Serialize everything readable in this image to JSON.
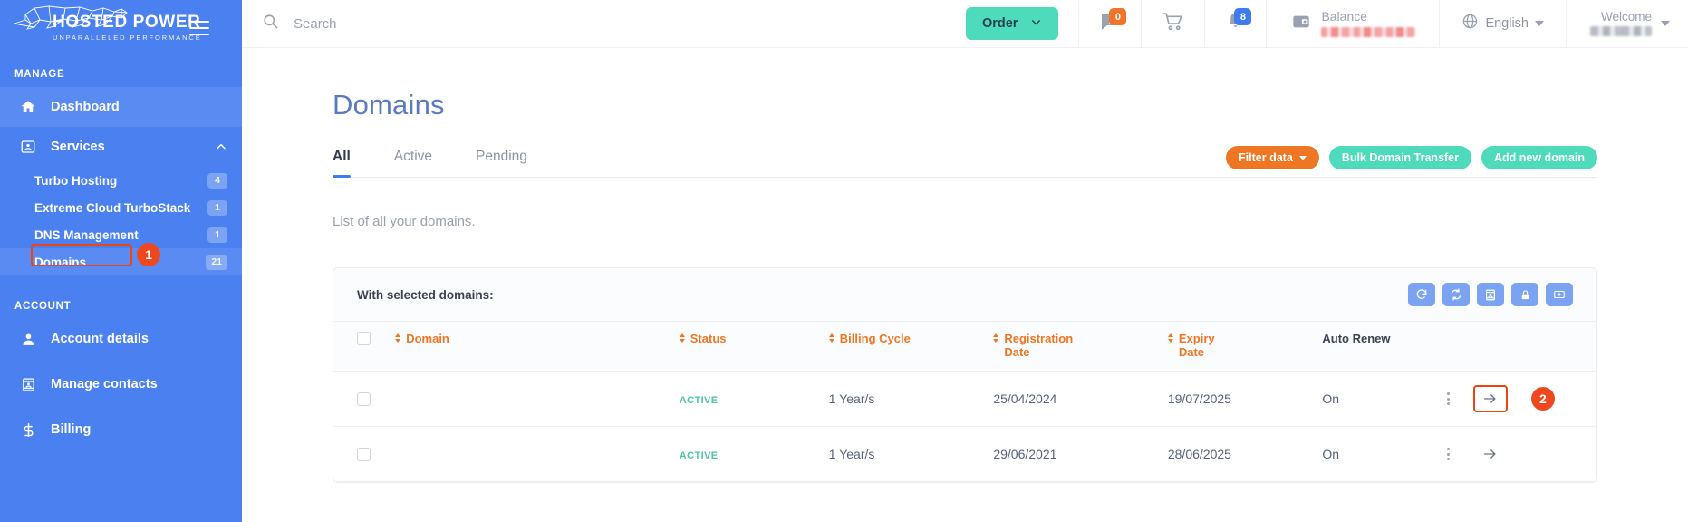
{
  "brand": {
    "name": "HOSTED POWER",
    "tagline": "UNPARALLELED PERFORMANCE",
    "logo_icon": "cheetah-logo-icon",
    "menu_icon": "hamburger-menu-icon"
  },
  "sidebar": {
    "sections": [
      {
        "label": "MANAGE"
      },
      {
        "label": "ACCOUNT"
      }
    ],
    "manage_items": [
      {
        "label": "Dashboard",
        "icon": "home-icon",
        "badge": null
      },
      {
        "label": "Services",
        "icon": "services-card-icon",
        "badge": null,
        "expand_icon": "chevron-up-icon"
      }
    ],
    "services_children": [
      {
        "label": "Turbo Hosting",
        "badge": "4"
      },
      {
        "label": "Extreme Cloud TurboStack",
        "badge": "1"
      },
      {
        "label": "DNS Management",
        "badge": "1"
      },
      {
        "label": "Domains",
        "badge": "21",
        "highlighted": true,
        "step": "1"
      }
    ],
    "account_items": [
      {
        "label": "Account details",
        "icon": "user-icon"
      },
      {
        "label": "Manage contacts",
        "icon": "contact-card-icon"
      },
      {
        "label": "Billing",
        "icon": "dollar-icon"
      }
    ]
  },
  "header": {
    "search": {
      "placeholder": "Search",
      "value": "",
      "icon": "search-icon"
    },
    "order": {
      "label": "Order",
      "icon": "chevron-down-icon"
    },
    "tickets": {
      "icon": "support-ticket-icon",
      "badge": "0"
    },
    "cart": {
      "icon": "shopping-cart-icon",
      "badge": null
    },
    "notifications": {
      "icon": "bell-icon",
      "badge": "8"
    },
    "balance": {
      "icon": "wallet-icon",
      "label": "Balance",
      "value": ""
    },
    "language": {
      "icon": "globe-icon",
      "label": "English",
      "caret": "caret-down-icon"
    },
    "welcome": {
      "label": "Welcome",
      "value": "",
      "caret": "caret-down-icon"
    }
  },
  "main": {
    "page_title": "Domains",
    "tabs": [
      {
        "label": "All",
        "active": true
      },
      {
        "label": "Active",
        "active": false
      },
      {
        "label": "Pending",
        "active": false
      }
    ],
    "actions": [
      {
        "label": "Filter data",
        "style": "orange",
        "caret": true
      },
      {
        "label": "Bulk Domain Transfer",
        "style": "teal",
        "caret": false
      },
      {
        "label": "Add new domain",
        "style": "teal",
        "caret": false
      }
    ],
    "list_note": "List of all your domains.",
    "card": {
      "selected_label": "With selected domains:",
      "bulk_icons": [
        "renew-icon",
        "auto-renew-sync-icon",
        "contacts-icon",
        "registrar-lock-icon",
        "nameservers-icon"
      ]
    },
    "table": {
      "columns": [
        {
          "label": "",
          "sortable": false,
          "key": "select"
        },
        {
          "label": "Domain",
          "sortable": true
        },
        {
          "label": "Status",
          "sortable": true
        },
        {
          "label": "Billing Cycle",
          "sortable": true
        },
        {
          "label": "Registration Date",
          "sortable": true
        },
        {
          "label": "Expiry Date",
          "sortable": true
        },
        {
          "label": "Auto Renew",
          "sortable": false
        },
        {
          "label": "",
          "sortable": false,
          "key": "actions"
        }
      ],
      "rows": [
        {
          "domain": "",
          "domain_redacted": true,
          "status": "ACTIVE",
          "billing_cycle": "1 Year/s",
          "registration_date": "25/04/2024",
          "expiry_date": "19/07/2025",
          "auto_renew": "On",
          "arrow_highlighted": true,
          "step": "2"
        },
        {
          "domain": "",
          "domain_redacted": true,
          "status": "ACTIVE",
          "billing_cycle": "1 Year/s",
          "registration_date": "29/06/2021",
          "expiry_date": "28/06/2025",
          "auto_renew": "On",
          "arrow_highlighted": false,
          "step": null
        }
      ]
    }
  },
  "colors": {
    "sidebar_blue": "#4a80f0",
    "accent_blue": "#3d7bf0",
    "teal": "#4ddbbb",
    "orange": "#ef7623",
    "annotation_red": "#ee4411",
    "status_green": "#4ec6a6",
    "title_blue": "#5b79bf"
  }
}
